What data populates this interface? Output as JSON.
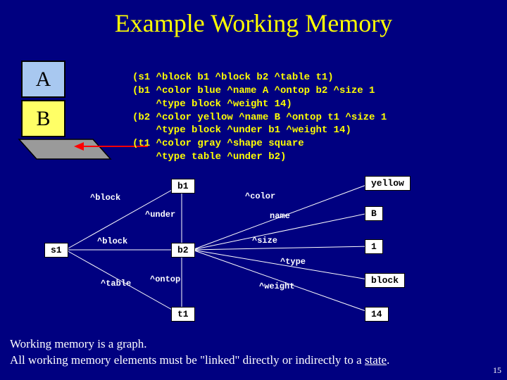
{
  "title": "Example Working Memory",
  "blocks": {
    "a": "A",
    "b": "B"
  },
  "code": {
    "l1": "(s1 ^block b1 ^block b2 ^table t1)",
    "l2": "(b1 ^color blue ^name A ^ontop b2 ^size 1",
    "l3": "    ^type block ^weight 14)",
    "l4": "(b2 ^color yellow ^name B ^ontop t1 ^size 1",
    "l5": "    ^type block ^under b1 ^weight 14)",
    "l6": "(t1 ^color gray ^shape square",
    "l7": "    ^type table ^under b2)"
  },
  "graph": {
    "nodes": {
      "s1": "s1",
      "b1": "b1",
      "b2": "b2",
      "t1": "t1",
      "yellow": "yellow",
      "vb": "B",
      "v1": "1",
      "block": "block",
      "v14": "14"
    },
    "edges": {
      "blk1": "^block",
      "blk2": "^block",
      "table": "^table",
      "under": "^under",
      "ontop": "^ontop",
      "color": "^color",
      "name": "name",
      "size": "^size",
      "type": "^type",
      "weight": "^weight"
    }
  },
  "footer": {
    "line1": "Working memory is a graph.",
    "line2a": "All working memory elements must be \"linked\" directly or indirectly to a ",
    "line2b": "state",
    "line2c": "."
  },
  "pagenum": "15"
}
